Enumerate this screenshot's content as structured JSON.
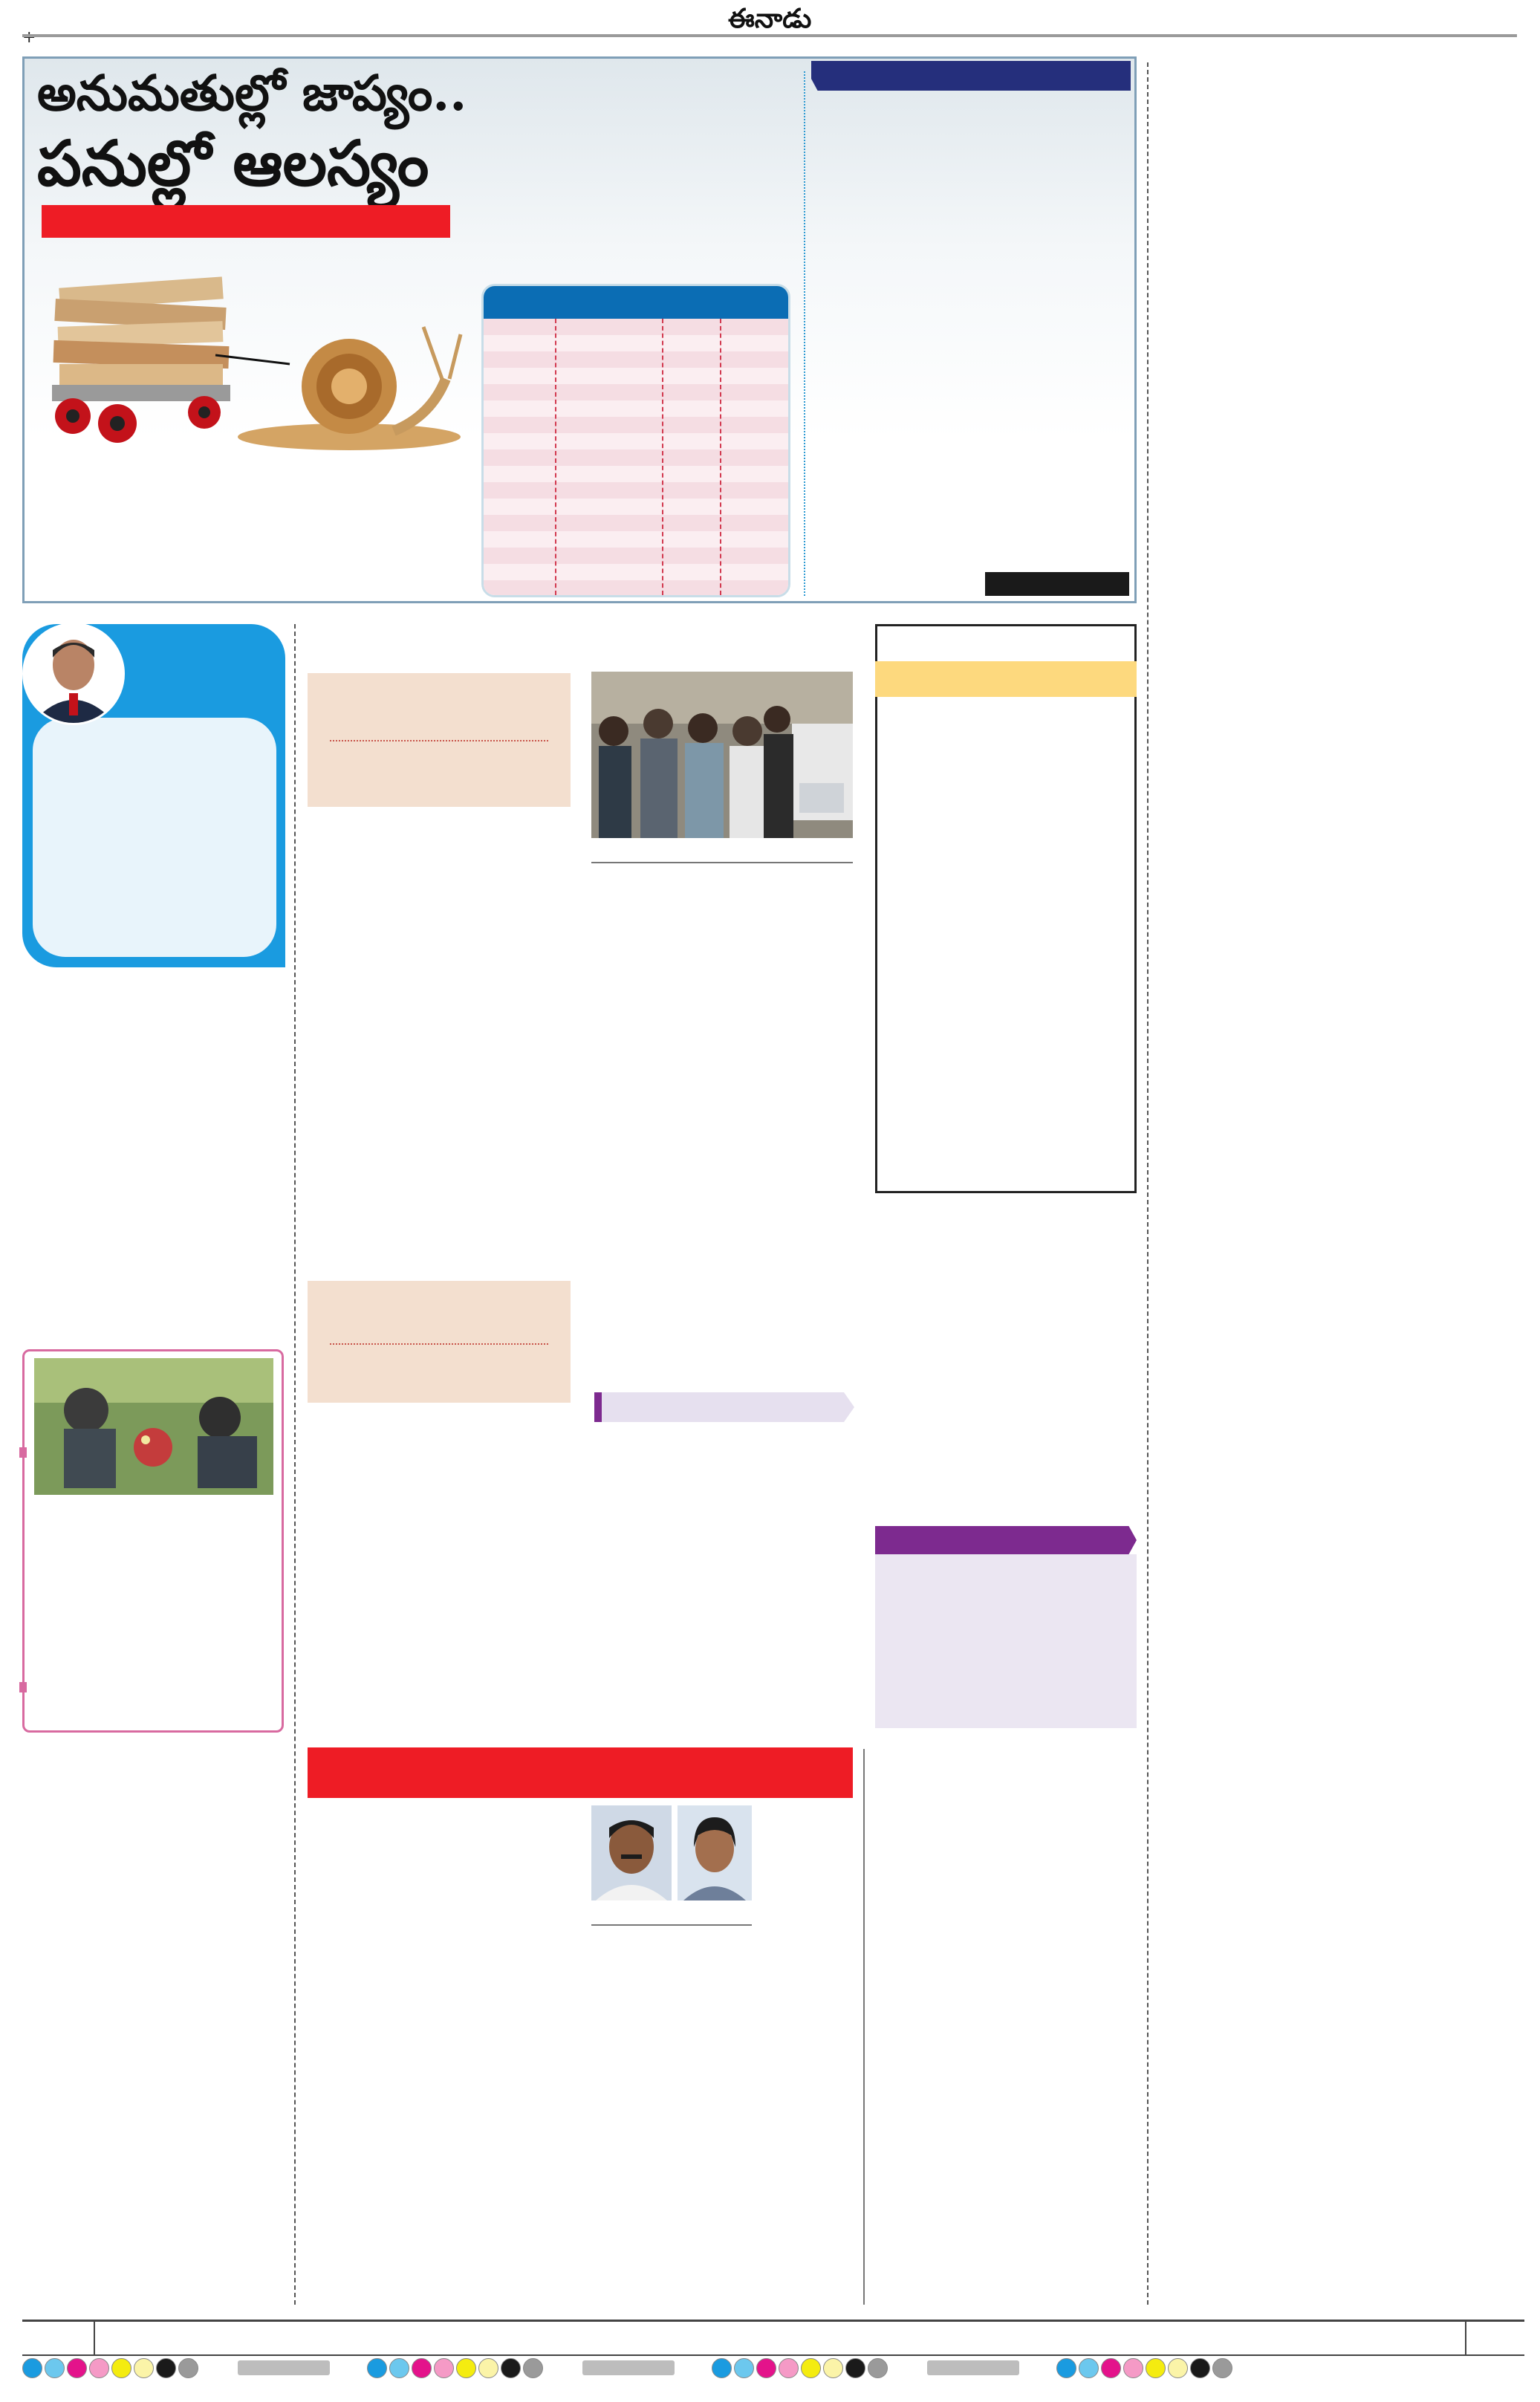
{
  "masthead": {
    "title": "ఈనాడు"
  },
  "hero": {
    "headline_line1": "అనుమతుల్లో జాప్యం..",
    "headline_line2": "పనుల్లో ఆలస్యం"
  },
  "colors": {
    "accent_red": "#ee1c25",
    "accent_blue": "#0b6db4",
    "accent_navy": "#252f7c",
    "accent_purple": "#7d2a8f",
    "accent_yellow": "#fdd97e",
    "profile_blue": "#1a9be0"
  },
  "registration_marks": {
    "colors": [
      "#1a9be0",
      "#6cc8ee",
      "#e4138b",
      "#f59ac6",
      "#f4ec10",
      "#fbf4a8",
      "#1a1a1a",
      "#9a9a9a"
    ]
  }
}
